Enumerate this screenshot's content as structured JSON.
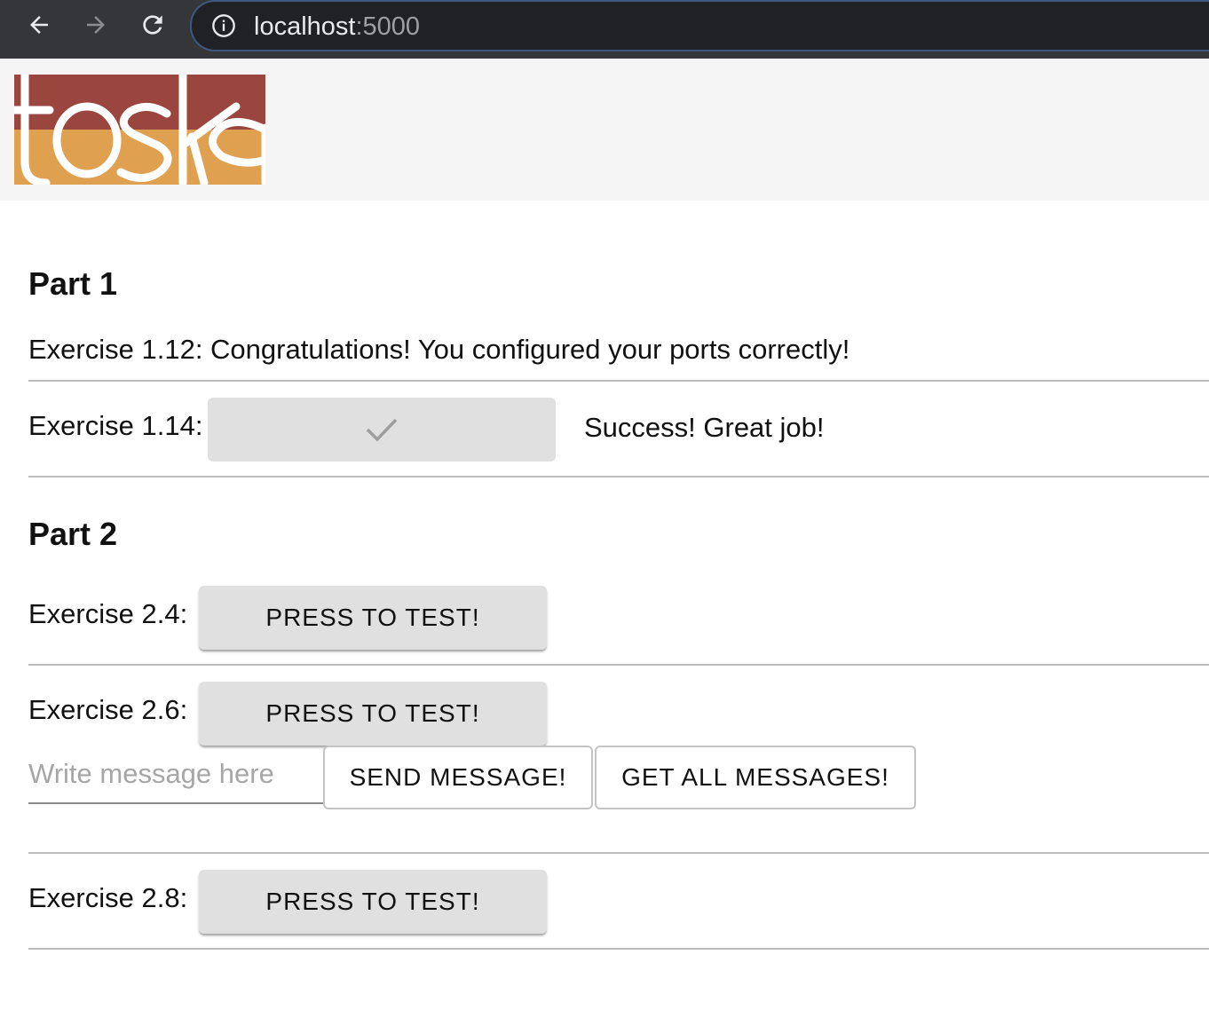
{
  "browser": {
    "url_host": "localhost",
    "url_port": ":5000"
  },
  "header": {
    "logo_text": "toska"
  },
  "part1": {
    "title": "Part 1",
    "ex112_text": "Exercise 1.12: Congratulations! You configured your ports correctly!",
    "ex114_label": "Exercise 1.14:",
    "ex114_status": "Success! Great job!"
  },
  "part2": {
    "title": "Part 2",
    "ex24_label": "Exercise 2.4:",
    "ex26_label": "Exercise 2.6:",
    "ex28_label": "Exercise 2.8:",
    "test_button_label": "PRESS TO TEST!",
    "message_placeholder": "Write message here",
    "send_button_label": "SEND MESSAGE!",
    "get_all_button_label": "GET ALL MESSAGES!"
  },
  "colors": {
    "logo_top": "#9a463e",
    "logo_bottom": "#dfa04f",
    "chrome_bg": "#35363a",
    "button_bg": "#e0e0e0"
  }
}
